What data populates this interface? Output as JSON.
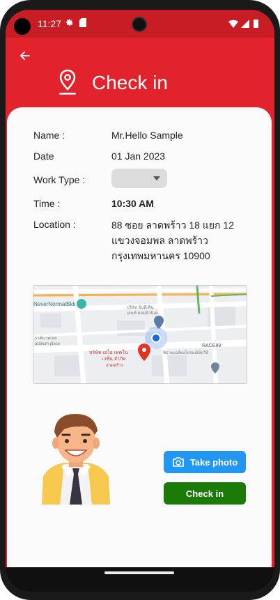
{
  "status_bar": {
    "time": "11:27",
    "icons": [
      "gear-icon",
      "sim-card-icon",
      "wifi-icon",
      "signal-icon",
      "battery-icon"
    ]
  },
  "header": {
    "title": "Check in",
    "back_icon": "arrow-left-icon",
    "title_icon": "location-pin-icon",
    "background": "#e3232b"
  },
  "form": {
    "name_label": "Name :",
    "name_value": "Mr.Hello Sample",
    "date_label": "Date",
    "date_value": "01 Jan 2023",
    "work_type_label": "Work Type :",
    "work_type_value": "",
    "time_label": "Time :",
    "time_value": "10:30 AM",
    "location_label": "Location :",
    "location_lines": [
      "88 ซอย ลาดพร้าว 18 แยก 12",
      "แขวงจอมพล ลาดพร้าว",
      "กรุงเทพมหานคร 10900"
    ]
  },
  "map": {
    "labels": {
      "brand": "NeverNormalBkk",
      "place1": "บริษัท อันดีเฟิน",
      "place1b": "เอนท์ คอมนิวนิเค",
      "place2": "ราคัม เพเลส",
      "place2b": "arakum place",
      "place3": "บริษัท เอไอ เทคโน",
      "place3b": "เวชั่น จำกัด",
      "place3c": "ลาดพร้าว",
      "place4": "RACE99",
      "place5": "พิธานเฉลียงไปรษณีย์ปวิธี"
    }
  },
  "actions": {
    "take_photo_label": "Take photo",
    "checkin_label": "Check in"
  },
  "colors": {
    "primary_red": "#e3232b",
    "take_photo_blue": "#2196f3",
    "checkin_green": "#1b7a08"
  }
}
